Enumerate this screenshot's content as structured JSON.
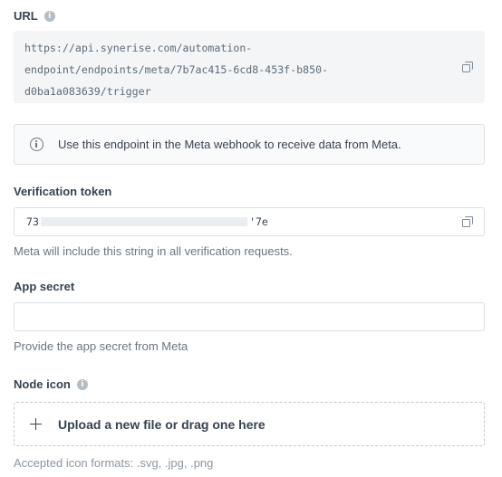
{
  "url_section": {
    "label": "URL",
    "url_lines": [
      "https://api.synerise.com/automation-",
      "endpoint/endpoints/meta/7b7ac415-6cd8-453f-b850-",
      "d0ba1a083639/trigger"
    ]
  },
  "info_banner": {
    "text": "Use this endpoint in the Meta webhook to receive data from Meta."
  },
  "verification_token": {
    "label": "Verification token",
    "value_prefix": "73",
    "value_suffix": "'7e",
    "hint": "Meta will include this string in all verification requests."
  },
  "app_secret": {
    "label": "App secret",
    "value": "",
    "hint": "Provide the app secret from Meta"
  },
  "node_icon": {
    "label": "Node icon",
    "upload_label": "Upload a new file or drag one here",
    "hint": "Accepted icon formats: .svg, .jpg, .png"
  }
}
